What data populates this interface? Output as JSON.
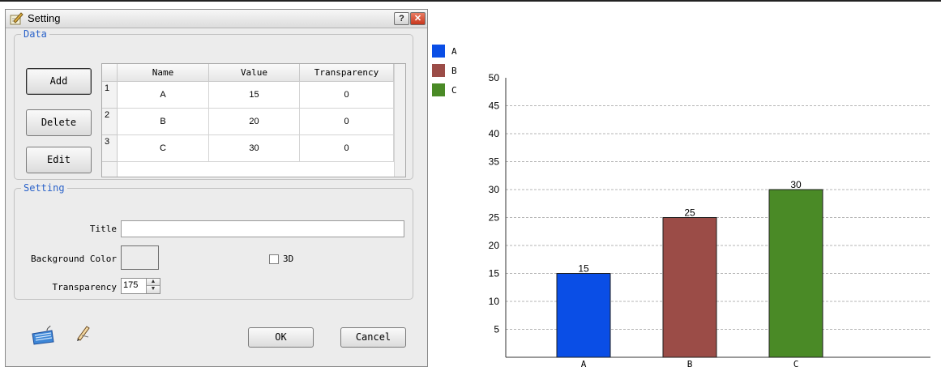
{
  "dialog": {
    "title": "Setting",
    "help_label": "?",
    "close_label": "✕",
    "data_group_label": "Data",
    "buttons": {
      "add": "Add",
      "delete": "Delete",
      "edit": "Edit",
      "ok": "OK",
      "cancel": "Cancel"
    },
    "table": {
      "columns": [
        "Name",
        "Value",
        "Transparency"
      ],
      "rows": [
        {
          "index": "1",
          "name": "A",
          "value": "15",
          "transparency": "0"
        },
        {
          "index": "2",
          "name": "B",
          "value": "20",
          "transparency": "0"
        },
        {
          "index": "3",
          "name": "C",
          "value": "30",
          "transparency": "0"
        }
      ]
    },
    "setting_group_label": "Setting",
    "fields": {
      "title_label": "Title",
      "title_value": "",
      "background_color_label": "Background Color",
      "background_color": "#ececec",
      "three_d_label": "3D",
      "three_d_checked": false,
      "transparency_label": "Transparency",
      "transparency_value": "175"
    },
    "icons": {
      "title": "pencil-paper-icon",
      "keyboard": "keyboard-icon",
      "pen": "pen-icon"
    }
  },
  "chart_data": {
    "type": "bar",
    "categories": [
      "A",
      "B",
      "C"
    ],
    "values": [
      15,
      25,
      30
    ],
    "data_labels": [
      "15",
      "25",
      "30"
    ],
    "colors": [
      "#0a4ee6",
      "#9b4c47",
      "#4a8a26"
    ],
    "legend": [
      {
        "label": "A",
        "color": "#0a4ee6"
      },
      {
        "label": "B",
        "color": "#9b4c47"
      },
      {
        "label": "C",
        "color": "#4a8a26"
      }
    ],
    "legend_position": "top-left",
    "y_ticks": [
      "5",
      "10",
      "15",
      "20",
      "25",
      "30",
      "35",
      "40",
      "45",
      "50"
    ],
    "ylim": [
      0,
      50
    ],
    "grid": true,
    "title": "",
    "xlabel": "",
    "ylabel": ""
  }
}
